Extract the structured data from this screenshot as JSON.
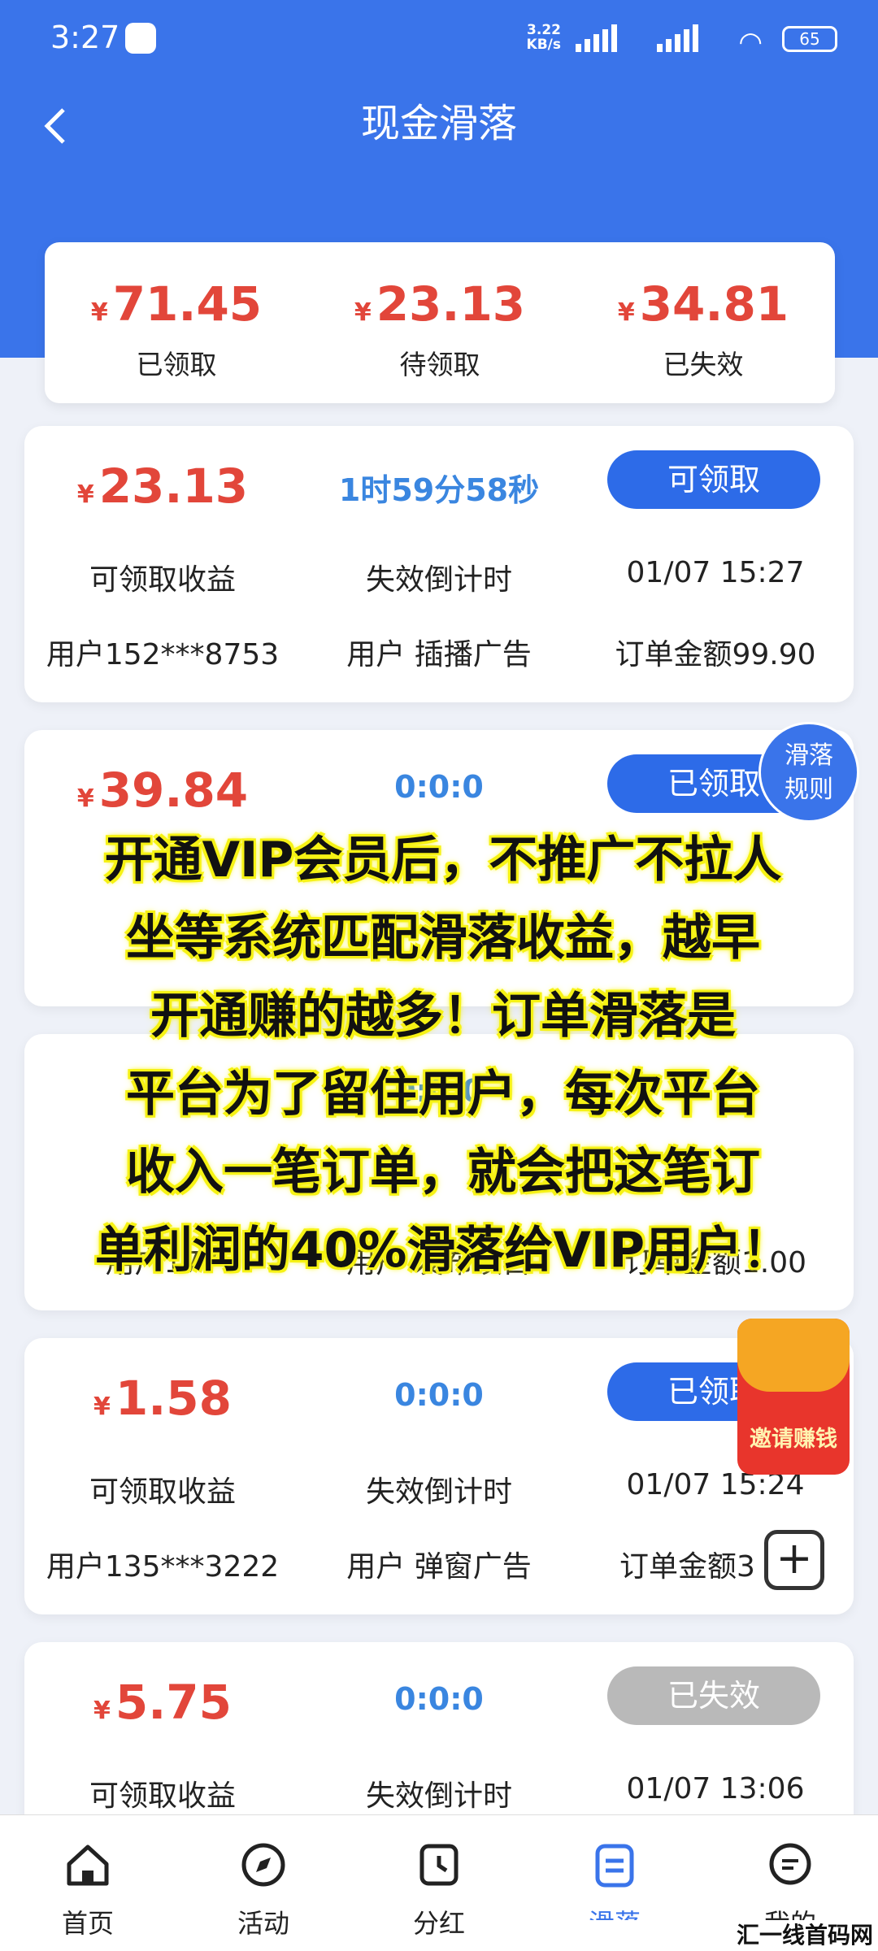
{
  "status_bar": {
    "time": "3:27",
    "net_speed": "3.22",
    "net_unit": "KB/s",
    "battery": "65"
  },
  "header": {
    "title": "现金滑落"
  },
  "summary": [
    {
      "value": "71.45",
      "label": "已领取"
    },
    {
      "value": "23.13",
      "label": "待领取"
    },
    {
      "value": "34.81",
      "label": "已失效"
    }
  ],
  "currency": "¥",
  "orders": [
    {
      "amount": "23.13",
      "countdown": "1时59分58秒",
      "button": "可领取",
      "amount_label": "可领取收益",
      "countdown_label": "失效倒计时",
      "time": "01/07 15:27",
      "user": "用户152***8753",
      "source": "用户 插播广告",
      "order_amount": "订单金额99.90"
    },
    {
      "amount": "39.84",
      "countdown": "0:0:0",
      "button": "已领取"
    },
    {
      "countdown": "0:0:0",
      "user": "用户177",
      "source": "用户 发布项目",
      "order_amount": "订单金额1.00"
    },
    {
      "amount": "1.58",
      "countdown": "0:0:0",
      "button": "已领取",
      "amount_label": "可领取收益",
      "countdown_label": "失效倒计时",
      "time": "01/07 15:24",
      "user": "用户135***3222",
      "source": "用户 弹窗广告",
      "order_amount": "订单金额3"
    },
    {
      "amount": "5.75",
      "countdown": "0:0:0",
      "button": "已失效",
      "amount_label": "可领取收益",
      "countdown_label": "失效倒计时",
      "time": "01/07 13:06"
    }
  ],
  "floating": {
    "rules_line1": "滑落",
    "rules_line2": "规则",
    "invite": "邀请赚钱",
    "plus": "+"
  },
  "overlay_lines": [
    "开通VIP会员后，不推广不拉人",
    "坐等系统匹配滑落收益，越早",
    "开通赚的越多！订单滑落是",
    "平台为了留住用户，每次平台",
    "收入一笔订单，就会把这笔订",
    "单利润的40%滑落给VIP用户！"
  ],
  "nav": [
    {
      "label": "首页",
      "icon": "home-icon"
    },
    {
      "label": "活动",
      "icon": "compass-icon"
    },
    {
      "label": "分红",
      "icon": "clock-icon"
    },
    {
      "label": "滑落",
      "icon": "clipboard-icon",
      "active": true
    },
    {
      "label": "我的",
      "icon": "chat-icon"
    }
  ],
  "watermark": "汇一线首码网 www.huiyixian.com",
  "colors": {
    "primary": "#3a74ea",
    "money": "#e2463a",
    "countdown": "#3a86e0",
    "expired": "#b9b9b9",
    "highlight": "#f6f216"
  }
}
